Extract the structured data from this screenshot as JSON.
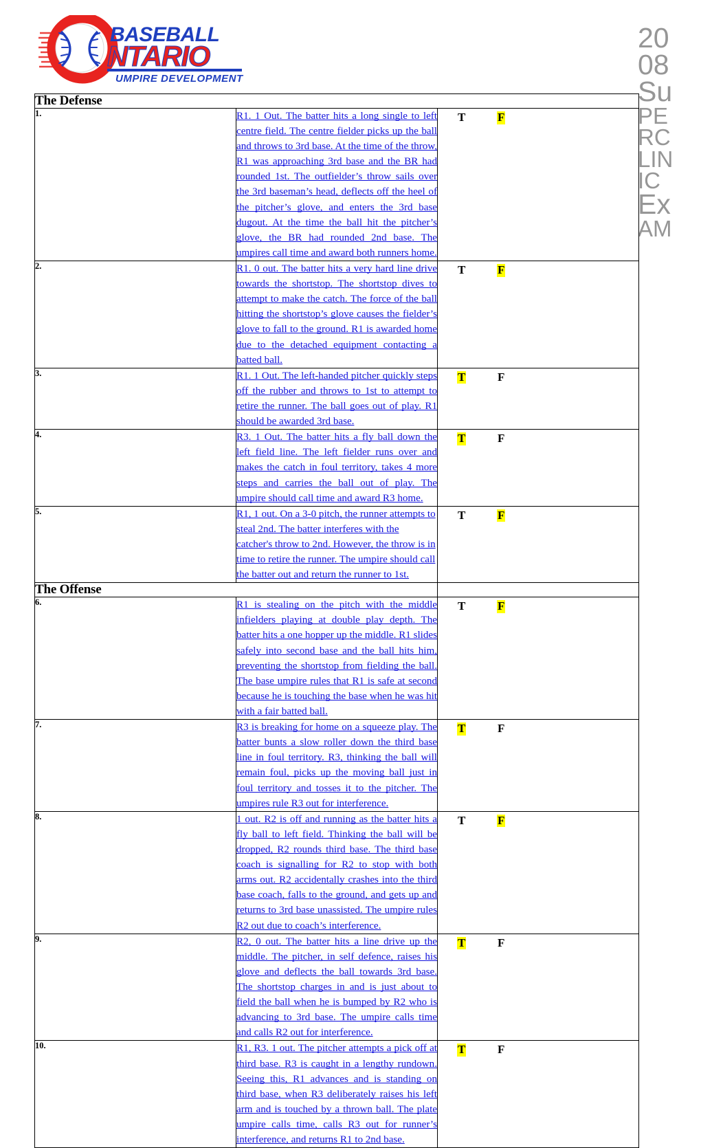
{
  "document": {
    "watermark_lines": [
      "20",
      "08",
      "Su",
      "PE",
      "RC",
      "LIN",
      "IC",
      "Ex",
      "AM"
    ],
    "watermark_text": "2008 SUPERCLINIC EXAM",
    "watermark_color": "#969696"
  },
  "logo": {
    "brand_line1": "BASEBALL",
    "brand_line2": "NTARIO",
    "tagline": "UMPIRE DEVELOPMENT",
    "blue": "#1f3fbf",
    "red": "#e8231f"
  },
  "answers": {
    "true_label": "T",
    "false_label": "F",
    "highlight_color": "#ffff00"
  },
  "sections": [
    {
      "title": "The Defense",
      "questions": [
        {
          "number": "1.",
          "text": "R1. 1 Out. The batter hits a long single to left centre field. The centre fielder picks up the ball and throws to 3rd base.  At the time of the throw, R1 was approaching 3rd base and the BR had rounded 1st.  The outfielder’s throw sails over the 3rd baseman’s head, deflects off the heel of the pitcher’s glove, and enters the 3rd base dugout. At the time the ball hit the pitcher’s glove, the BR had rounded 2nd base.   The umpires call time and award both runners home.",
          "selected": "F",
          "align": "justify"
        },
        {
          "number": "2.",
          "text": "R1. 0 out. The batter hits a very hard line drive towards the shortstop. The shortstop dives to attempt to make the catch. The force of the ball hitting the shortstop’s glove causes the fielder’s glove to fall to the ground. R1 is awarded home due to the detached equipment contacting a batted ball.",
          "selected": "F",
          "align": "justify"
        },
        {
          "number": "3.",
          "text": "R1. 1 Out. The left-handed pitcher quickly steps off the rubber and throws to 1st to attempt to retire the runner. The ball goes out of play. R1 should be awarded 3rd base.",
          "selected": "T",
          "align": "justify"
        },
        {
          "number": "4.",
          "text": "R3. 1 Out. The batter hits a fly ball down the left field line. The left fielder runs over and makes the catch in foul territory, takes 4 more steps and carries the ball out of play. The umpire should call time and award R3 home.",
          "selected": "T",
          "align": "justify"
        },
        {
          "number": "5.",
          "text": "R1, 1 out. On a 3-0 pitch, the runner attempts to steal 2nd. The batter interferes with the catcher's throw to 2nd. However, the throw is in time to retire the runner. The umpire should call the batter out and return the runner to 1st.",
          "selected": "F",
          "align": "left"
        }
      ]
    },
    {
      "title": "The Offense",
      "questions": [
        {
          "number": "6.",
          "text": "R1 is stealing on the pitch with the middle infielders playing at double play depth. The batter hits a one hopper up the middle.   R1 slides safely into second base and the ball hits him, preventing the shortstop from fielding the ball. The base umpire rules that R1 is safe at second because he is touching the base when he was hit with a fair batted ball.",
          "selected": "F",
          "align": "justify"
        },
        {
          "number": "7.",
          "text": "R3 is breaking for home on a squeeze play.  The batter bunts a slow roller down the third base line in foul territory.  R3, thinking the ball will remain foul, picks up the moving ball just in foul territory and tosses it to the pitcher.  The umpires rule R3 out for interference.",
          "selected": "T",
          "align": "justify"
        },
        {
          "number": "8.",
          "text": "1 out.  R2 is off and running as the batter hits a fly ball to left field. Thinking the ball will be dropped, R2 rounds third base.  The third base coach is signalling for R2 to stop with both arms out.  R2 accidentally crashes into the third base coach, falls to the ground, and gets up and returns to 3rd base unassisted. The umpire rules R2 out due to coach’s interference.",
          "selected": "F",
          "align": "justify"
        },
        {
          "number": "9.",
          "text": "R2, 0 out.  The batter hits a line drive up the middle.  The pitcher, in self defence, raises his glove and deflects the ball towards 3rd base.  The shortstop charges in and is just about to field the ball when he is bumped by R2 who is advancing to 3rd base.  The umpire calls time and calls R2 out for interference. ",
          "selected": "T",
          "align": "justify"
        },
        {
          "number": "10.",
          "text": "R1, R3. 1 out.  The pitcher attempts a pick off at third base.  R3 is caught in a lengthy rundown.  Seeing this, R1 advances and is standing on third base, when R3 deliberately raises his left arm and is touched by a thrown ball.  The plate umpire calls time, calls R3 out for runner’s interference, and returns R1 to 2nd base. ",
          "selected": "T",
          "align": "justify"
        }
      ]
    }
  ]
}
